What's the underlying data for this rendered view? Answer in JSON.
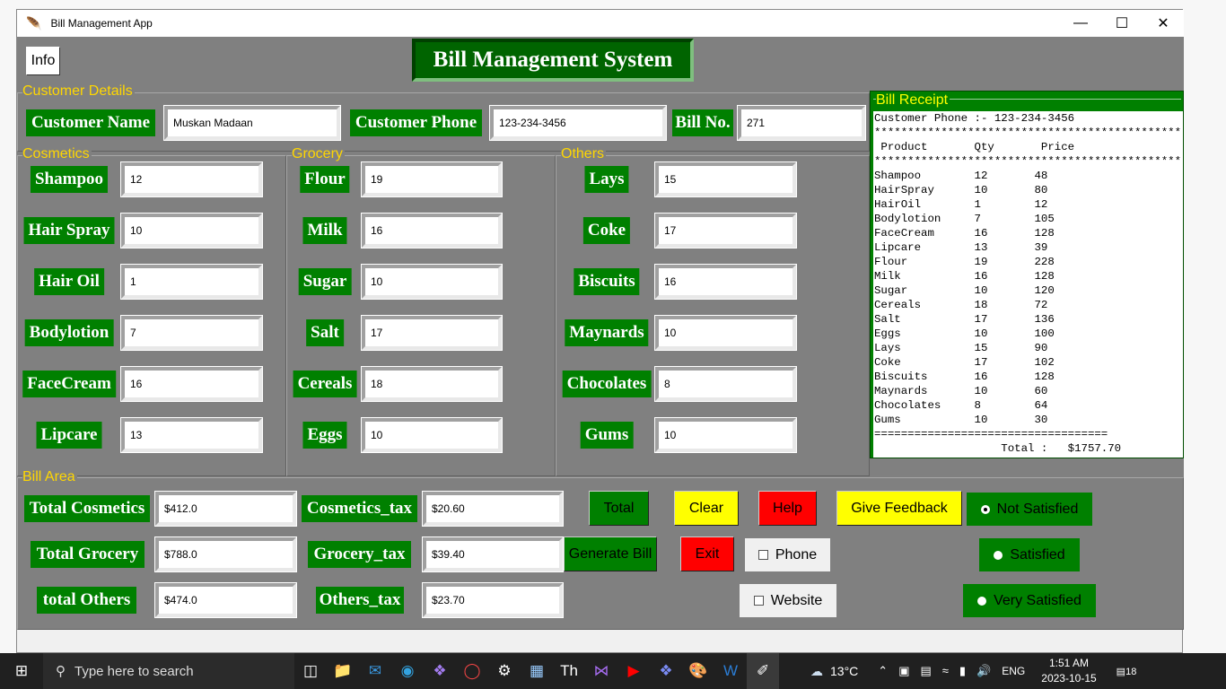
{
  "window": {
    "title": "Bill Management App"
  },
  "header": {
    "info_button": "Info",
    "title": "Bill Management System"
  },
  "customer": {
    "frame_label": "Customer Details",
    "name_label": "Customer Name",
    "name_value": "Muskan Madaan",
    "phone_label": "Customer Phone",
    "phone_value": "123-234-3456",
    "bill_label": "Bill No.",
    "bill_value": "271"
  },
  "cosmetics": {
    "frame_label": "Cosmetics",
    "items": [
      {
        "label": "Shampoo",
        "value": "12"
      },
      {
        "label": "Hair Spray",
        "value": "10"
      },
      {
        "label": "Hair Oil",
        "value": "1"
      },
      {
        "label": "Bodylotion",
        "value": "7"
      },
      {
        "label": "FaceCream",
        "value": "16"
      },
      {
        "label": "Lipcare",
        "value": "13"
      }
    ]
  },
  "grocery": {
    "frame_label": "Grocery",
    "items": [
      {
        "label": "Flour",
        "value": "19"
      },
      {
        "label": "Milk",
        "value": "16"
      },
      {
        "label": "Sugar",
        "value": "10"
      },
      {
        "label": "Salt",
        "value": "17"
      },
      {
        "label": "Cereals",
        "value": "18"
      },
      {
        "label": "Eggs",
        "value": "10"
      }
    ]
  },
  "others": {
    "frame_label": "Others",
    "items": [
      {
        "label": "Lays",
        "value": "15"
      },
      {
        "label": "Coke",
        "value": "17"
      },
      {
        "label": "Biscuits",
        "value": "16"
      },
      {
        "label": "Maynards",
        "value": "10"
      },
      {
        "label": "Chocolates",
        "value": "8"
      },
      {
        "label": "Gums",
        "value": "10"
      }
    ]
  },
  "bill_area": {
    "frame_label": "Bill Area",
    "total_cosmetics_label": "Total Cosmetics",
    "total_cosmetics": "$412.0",
    "total_grocery_label": "Total Grocery",
    "total_grocery": "$788.0",
    "total_others_label": "total Others",
    "total_others": "$474.0",
    "cosmetics_tax_label": "Cosmetics_tax",
    "cosmetics_tax": "$20.60",
    "grocery_tax_label": "Grocery_tax",
    "grocery_tax": "$39.40",
    "others_tax_label": "Others_tax",
    "others_tax": "$23.70",
    "buttons": {
      "total": "Total",
      "clear": "Clear",
      "help": "Help",
      "feedback": "Give Feedback",
      "generate": "Generate Bill",
      "exit": "Exit"
    },
    "checkboxes": {
      "phone": "Phone",
      "website": "Website"
    },
    "radios": {
      "not_satisfied": "Not Satisfied",
      "satisfied": "Satisfied",
      "very_satisfied": "Very Satisfied",
      "selected": "not_satisfied"
    }
  },
  "colors": {
    "green": "#008000",
    "yellow": "#ffff00",
    "red": "#ff0000",
    "gray": "#808080",
    "frame_label": "#ffd700"
  },
  "receipt": {
    "frame_label": "Bill Receipt",
    "text": "Customer Phone :- 123-234-3456\n**********************************************\n Product       Qty       Price\n**********************************************\nShampoo        12       48\nHairSpray      10       80\nHairOil        1        12\nBodylotion     7        105\nFaceCream      16       128\nLipcare        13       39\nFlour          19       228\nMilk           16       128\nSugar          10       120\nCereals        18       72\nSalt           17       136\nEggs           10       100\nLays           15       90\nCoke           17       102\nBiscuits       16       128\nMaynards       10       60\nChocolates     8        64\nGums           10       30\n===================================\n                   Total :   $1757.70"
  },
  "taskbar": {
    "search_placeholder": "Type here to search",
    "weather": "13°C",
    "lang": "ENG",
    "time": "1:51 AM",
    "date": "2023-10-15",
    "notifications": "18"
  }
}
